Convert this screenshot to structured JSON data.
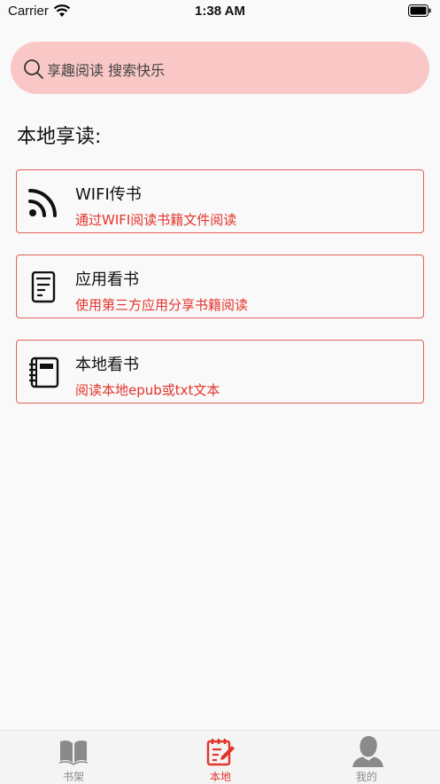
{
  "status_bar": {
    "carrier": "Carrier",
    "time": "1:38 AM"
  },
  "search": {
    "placeholder": "享趣阅读 搜索快乐"
  },
  "section_title": "本地享读:",
  "cards": [
    {
      "icon": "rss-icon",
      "title": "WIFI传书",
      "desc": "通过WIFI阅读书籍文件阅读"
    },
    {
      "icon": "document-icon",
      "title": "应用看书",
      "desc": "使用第三方应用分享书籍阅读"
    },
    {
      "icon": "notebook-icon",
      "title": "本地看书",
      "desc": "阅读本地epub或txt文本"
    }
  ],
  "tabs": [
    {
      "icon": "bookshelf-icon",
      "label": "书架",
      "active": false
    },
    {
      "icon": "edit-note-icon",
      "label": "本地",
      "active": true
    },
    {
      "icon": "user-icon",
      "label": "我的",
      "active": false
    }
  ],
  "colors": {
    "accent": "#e3342c",
    "search_bg": "#f9c8c6",
    "card_border": "#e0615a"
  }
}
